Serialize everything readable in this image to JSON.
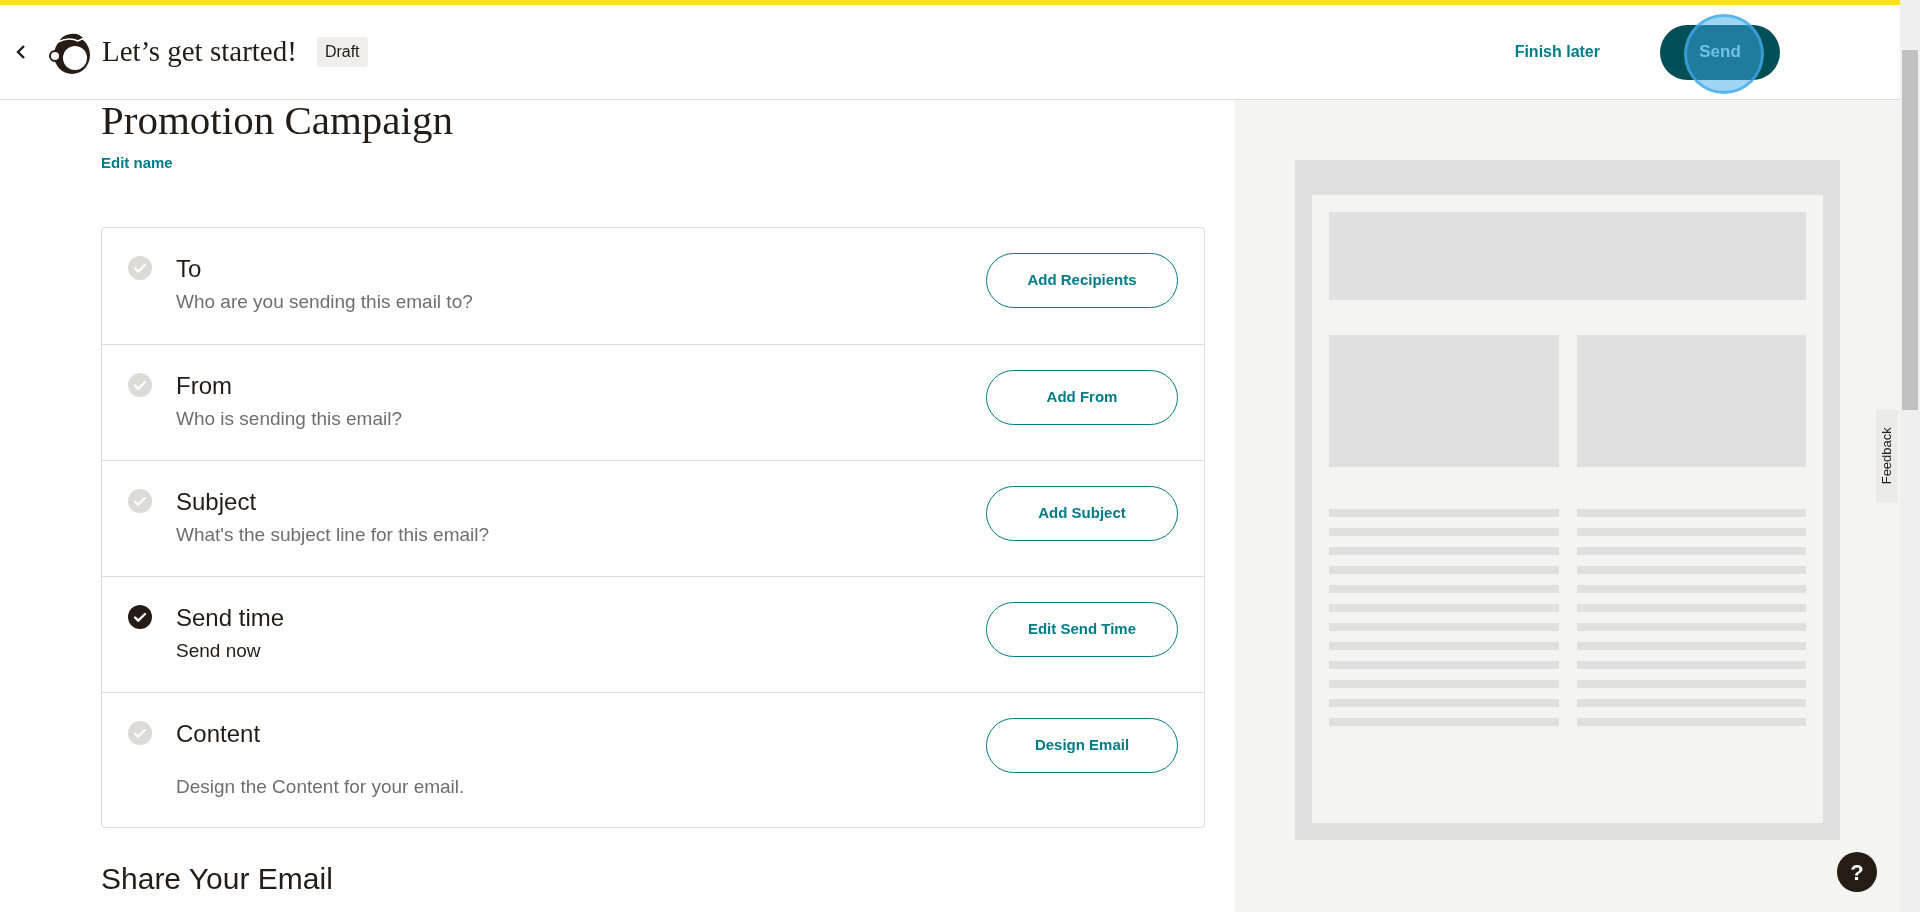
{
  "header": {
    "title": "Let’s get started!",
    "badge": "Draft",
    "finish_later": "Finish later",
    "send": "Send"
  },
  "campaign": {
    "name": "Promotion Campaign",
    "edit_name": "Edit name"
  },
  "checklist": [
    {
      "title": "To",
      "description": "Who are you sending this email to?",
      "done": false,
      "action": "Add Recipients"
    },
    {
      "title": "From",
      "description": "Who is sending this email?",
      "done": false,
      "action": "Add From"
    },
    {
      "title": "Subject",
      "description": "What's the subject line for this email?",
      "done": false,
      "action": "Add Subject"
    },
    {
      "title": "Send time",
      "description": "Send now",
      "done": true,
      "action": "Edit Send Time"
    },
    {
      "title": "Content",
      "description": "Design the Content for your email.",
      "done": false,
      "action": "Design Email"
    }
  ],
  "share": {
    "title": "Share Your Email"
  },
  "feedback": "Feedback",
  "help": "?"
}
